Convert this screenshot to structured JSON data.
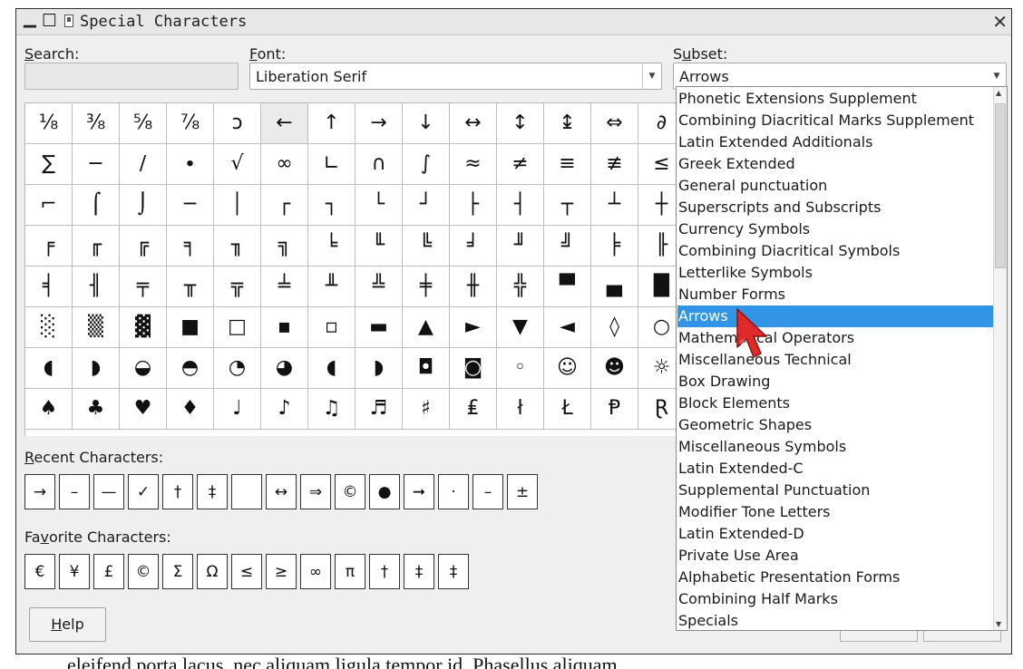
{
  "window": {
    "title": "Special Characters"
  },
  "search": {
    "label_prefix": "",
    "label_underlined": "S",
    "label_rest": "earch:",
    "value": ""
  },
  "font": {
    "label_underlined": "F",
    "label_rest": "ont:",
    "value": "Liberation Serif"
  },
  "subset": {
    "label_prefix": "S",
    "label_underlined": "u",
    "label_rest": "bset:",
    "value": "Arrows"
  },
  "grid": {
    "cells": [
      "⅛",
      "⅜",
      "⅝",
      "⅞",
      "ↄ",
      "←",
      "↑",
      "→",
      "↓",
      "↔",
      "↕",
      "↨",
      "⇔",
      "∂",
      "∑",
      "−",
      "∕",
      "∙",
      "√",
      "∞",
      "∟",
      "∩",
      "∫",
      "≈",
      "≠",
      "≡",
      "≢",
      "≤",
      "⌐",
      "⌠",
      "⌡",
      "─",
      "│",
      "┌",
      "┐",
      "└",
      "┘",
      "├",
      "┤",
      "┬",
      "┴",
      "┼",
      "╒",
      "╓",
      "╔",
      "╕",
      "╖",
      "╗",
      "╘",
      "╙",
      "╚",
      "╛",
      "╜",
      "╝",
      "╞",
      "╟",
      "╡",
      "╢",
      "╤",
      "╥",
      "╦",
      "╧",
      "╨",
      "╩",
      "╪",
      "╫",
      "╬",
      "▀",
      "▄",
      "█",
      "░",
      "▒",
      "▓",
      "■",
      "□",
      "▪",
      "▫",
      "▬",
      "▲",
      "►",
      "▼",
      "◄",
      "◊",
      "○",
      "◖",
      "◗",
      "◒",
      "◓",
      "◔",
      "◕",
      "◖",
      "◗",
      "◘",
      "◙",
      "◦",
      "☺",
      "☻",
      "☼",
      "♠",
      "♣",
      "♥",
      "♦",
      "♩",
      "♪",
      "♫",
      "♬",
      "♯",
      "₤",
      "ł",
      "Ł",
      "Ᵽ",
      "Ɽ"
    ],
    "selected_index": 5
  },
  "recent": {
    "label_underlined": "R",
    "label_rest": "ecent Characters:",
    "chars": [
      "→",
      "–",
      "—",
      "✓",
      "†",
      "‡",
      " ",
      "↔",
      "⇒",
      "©",
      "●",
      "➞",
      "·",
      "–",
      "±"
    ]
  },
  "favorites": {
    "label_prefix": "Fa",
    "label_underlined": "v",
    "label_rest": "orite Characters:",
    "chars": [
      "€",
      "¥",
      "£",
      "©",
      "Σ",
      "Ω",
      "≤",
      "≥",
      "∞",
      "π",
      "†",
      "‡",
      "‡"
    ]
  },
  "help_button": {
    "label_underlined": "H",
    "label_rest": "elp"
  },
  "dropdown": {
    "items": [
      "Phonetic Extensions Supplement",
      "Combining Diacritical Marks Supplement",
      "Latin Extended Additionals",
      "Greek Extended",
      "General punctuation",
      "Superscripts and Subscripts",
      "Currency Symbols",
      "Combining Diacritical Symbols",
      "Letterlike Symbols",
      "Number Forms",
      "Arrows",
      "Mathematical Operators",
      "Miscellaneous Technical",
      "Box Drawing",
      "Block Elements",
      "Geometric Shapes",
      "Miscellaneous Symbols",
      "Latin Extended-C",
      "Supplemental Punctuation",
      "Modifier Tone Letters",
      "Latin Extended-D",
      "Private Use Area",
      "Alphabetic Presentation Forms",
      "Combining Half Marks",
      "Specials"
    ],
    "highlighted_index": 10
  },
  "background_document": {
    "text": "eleifend porta lacus, nec aliquam ligula tempor id. Phasellus aliquam"
  },
  "icons": {
    "close": "close-icon",
    "minimize": "minimize-icon",
    "maximize": "maximize-icon"
  },
  "colors": {
    "highlight": "#3294e7",
    "selected_cell": "#ebebeb"
  }
}
